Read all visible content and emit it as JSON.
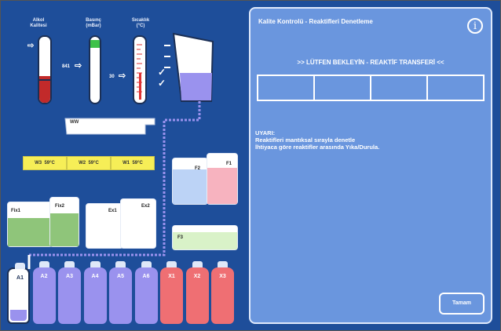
{
  "gauges": {
    "alkol_label_1": "Alkol",
    "alkol_label_2": "Kalitesi",
    "basinc_label_1": "Basınç",
    "basinc_label_2": "(mBar)",
    "sicaklik_label_1": "Sıcaklık",
    "sicaklik_label_2": "(°C)",
    "basinc_value": "841",
    "sicaklik_value": "30",
    "alkol_fill_fraction": 0.4,
    "basinc_level_fraction": 0.85,
    "sicaklik_level_fraction": 0.6
  },
  "ww_label": "WW",
  "wax_baths": [
    {
      "name": "W3",
      "temp": "59°C"
    },
    {
      "name": "W2",
      "temp": "59°C"
    },
    {
      "name": "W1",
      "temp": "59°C"
    }
  ],
  "cans": {
    "fix1": "Fix1",
    "fix2": "Fix2",
    "ex1": "Ex1",
    "ex2": "Ex2",
    "f1": "F1",
    "f2": "F2",
    "f3": "F3"
  },
  "bottles": [
    {
      "name": "A1",
      "color": "#ffffff"
    },
    {
      "name": "A2",
      "color": "#9a92ee"
    },
    {
      "name": "A3",
      "color": "#9a92ee"
    },
    {
      "name": "A4",
      "color": "#9a92ee"
    },
    {
      "name": "A5",
      "color": "#9a92ee"
    },
    {
      "name": "A6",
      "color": "#9a92ee"
    },
    {
      "name": "X1",
      "color": "#ef6f73"
    },
    {
      "name": "X2",
      "color": "#ef6f73"
    },
    {
      "name": "X3",
      "color": "#ef6f73"
    }
  ],
  "panel": {
    "title": "Kalite Kontrolü - Reaktifleri Denetleme",
    "info_icon": "i",
    "status": ">> LÜTFEN BEKLEYİN - REAKTİF TRANSFERİ <<",
    "warning_title": "UYARI:",
    "warning_line1": "Reaktifleri mantıksal sırayla denetle",
    "warning_line2": "İhtiyaca göre reaktifler arasında Yıka/Durula.",
    "ok_button": "Tamam"
  },
  "colors": {
    "background": "#1e4e9a",
    "panel": "#6a96de",
    "red": "#ef6f73",
    "purple": "#9a92ee",
    "green": "#8fc57a",
    "blue_can": "#bcd3f6",
    "pink_can": "#f7b3bf",
    "wax": "#f6ee57"
  }
}
